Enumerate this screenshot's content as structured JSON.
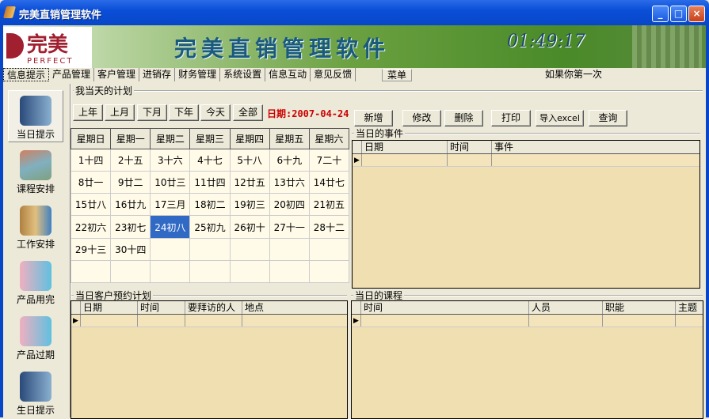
{
  "window": {
    "title": "完美直销管理软件",
    "minimize": "_",
    "maximize": "□",
    "close": "×"
  },
  "banner": {
    "logo_cn": "完美",
    "logo_en": "PERFECT",
    "title": "完美直销管理软件",
    "clock": "01:49:17"
  },
  "menu": {
    "items": [
      "信息提示",
      "产品管理",
      "客户管理",
      "进销存",
      "财务管理",
      "系统设置",
      "信息互动",
      "意见反馈"
    ],
    "extra": "菜单",
    "marquee": "如果你第一次"
  },
  "sidebar": {
    "items": [
      {
        "label": "当日提示",
        "icon": "computer-tower-icon"
      },
      {
        "label": "课程安排",
        "icon": "chart-icon"
      },
      {
        "label": "工作安排",
        "icon": "work-icon"
      },
      {
        "label": "产品用完",
        "icon": "product-empty-icon"
      },
      {
        "label": "产品过期",
        "icon": "product-expired-icon"
      },
      {
        "label": "生日提示",
        "icon": "birthday-icon"
      }
    ]
  },
  "plan": {
    "label": "我当天的计划",
    "nav_buttons": [
      "上年",
      "上月",
      "下月",
      "下年",
      "今天",
      "全部"
    ],
    "date": "日期:2007-04-24",
    "weekdays": [
      "星期日",
      "星期一",
      "星期二",
      "星期三",
      "星期四",
      "星期五",
      "星期六"
    ],
    "weeks": [
      [
        "1十四",
        "2十五",
        "3十六",
        "4十七",
        "5十八",
        "6十九",
        "7二十"
      ],
      [
        "8廿一",
        "9廿二",
        "10廿三",
        "11廿四",
        "12廿五",
        "13廿六",
        "14廿七"
      ],
      [
        "15廿八",
        "16廿九",
        "17三月",
        "18初二",
        "19初三",
        "20初四",
        "21初五"
      ],
      [
        "22初六",
        "23初七",
        "24初八",
        "25初九",
        "26初十",
        "27十一",
        "28十二"
      ],
      [
        "29十三",
        "30十四",
        "",
        "",
        "",
        "",
        ""
      ],
      [
        "",
        "",
        "",
        "",
        "",
        "",
        ""
      ]
    ],
    "selected": "24初八"
  },
  "actions": [
    "新增",
    "修改",
    "删除",
    "打印",
    "导入excel",
    "查询"
  ],
  "events": {
    "label": "当日的事件",
    "columns": [
      "日期",
      "时间",
      "事件"
    ]
  },
  "appointments": {
    "label": "当日客户预约计划",
    "columns": [
      "日期",
      "时间",
      "要拜访的人",
      "地点"
    ]
  },
  "courses": {
    "label": "当日的课程",
    "columns": [
      "时间",
      "人员",
      "职能",
      "主题"
    ]
  },
  "colors": {
    "title_bar": "#0a4fd8",
    "grid_bg": "#f0dfb0",
    "selected": "#316ac5",
    "date": "#cc0000"
  }
}
